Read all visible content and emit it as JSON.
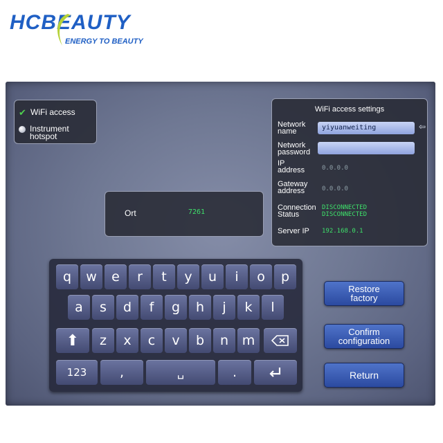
{
  "brand": {
    "name": "HCBEAUTY",
    "tagline": "ENERGY TO BEAUTY"
  },
  "mode_panel": {
    "wifi_label": "WiFi access",
    "hotspot_label": "Instrument hotspot",
    "hotspot_line1": "Instrument",
    "hotspot_line2": "hotspot"
  },
  "port": {
    "label": "Ort",
    "value": "7261"
  },
  "wifi_settings": {
    "title": "WiFi access settings",
    "network_name": {
      "label1": "Network",
      "label2": "name",
      "value": "yiyuanweiting"
    },
    "network_password": {
      "label1": "Network",
      "label2": "password",
      "value": ""
    },
    "ip_address": {
      "label1": "IP",
      "label2": "address",
      "value": "0.0.0.0"
    },
    "gateway_address": {
      "label1": "Gateway",
      "label2": "address",
      "value": "0.0.0.0"
    },
    "connection_status": {
      "label1": "Connection",
      "label2": "Status",
      "value1": "DISCONNECTED",
      "value2": "DISCONNECTED"
    },
    "server_ip": {
      "label": "Server IP",
      "value": "192.168.0.1"
    }
  },
  "keyboard": {
    "row1": [
      "q",
      "w",
      "e",
      "r",
      "t",
      "y",
      "u",
      "i",
      "o",
      "p"
    ],
    "row2": [
      "a",
      "s",
      "d",
      "f",
      "g",
      "h",
      "j",
      "k",
      "l"
    ],
    "row3": [
      "z",
      "x",
      "c",
      "v",
      "b",
      "n",
      "m"
    ],
    "numbers_key": "123",
    "comma_key": ",",
    "period_key": "."
  },
  "actions": {
    "restore_line1": "Restore",
    "restore_line2": "factory",
    "confirm_line1": "Confirm",
    "confirm_line2": "configuration",
    "return_label": "Return"
  },
  "colors": {
    "brand_blue": "#1f5fc4",
    "status_green": "#3ee06a",
    "button_blue": "#3a5cb5"
  }
}
